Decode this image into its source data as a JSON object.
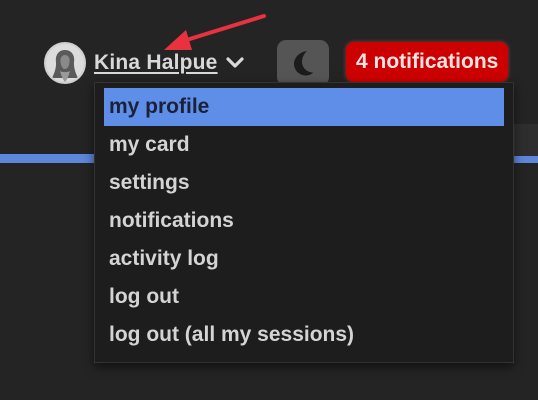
{
  "header": {
    "username": "Kina Halpue",
    "notifications_label": "4 notifications"
  },
  "icons": {
    "avatar": "user-avatar",
    "chevron": "chevron-down-icon",
    "theme": "moon-icon"
  },
  "colors": {
    "background": "#242424",
    "accent_blue": "#5f86db",
    "menu_highlight": "#5f8ee8",
    "notification_red": "#cc0000",
    "annotation_arrow": "#e8323f"
  },
  "user_menu": {
    "items": [
      {
        "label": "my profile",
        "active": true
      },
      {
        "label": "my card"
      },
      {
        "label": "settings"
      },
      {
        "label": "notifications"
      },
      {
        "label": "activity log"
      },
      {
        "label": "log out"
      },
      {
        "label": "log out (all my sessions)"
      }
    ]
  }
}
